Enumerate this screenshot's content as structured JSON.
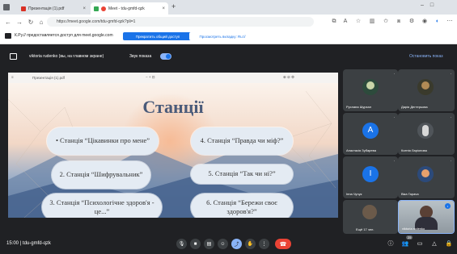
{
  "browser": {
    "tabs": [
      {
        "label": "Презентація (1).pdf",
        "active": false
      },
      {
        "label": "Meet - tdu-gmfd-qzk",
        "active": true
      }
    ],
    "new_tab_icon": "plus-icon",
    "url": "https://meet.google.com/tdu-gmfd-qzk?pli=1",
    "share_message": "К.Ру.// предоставляется доступ для meet.google.com",
    "share_primary_button": "Прекратить общий доступ",
    "share_secondary_button": "Просмотреть вкладку: Ru://"
  },
  "meet": {
    "presenter_label": "viktoria rudenko (вы, на главном экране)",
    "sound_label": "Звук показа",
    "stop_presenting": "Остановить показ",
    "meeting_time": "15:00",
    "meeting_code": "tdu-gmfd-qzk",
    "others_count": "Ещё 17 чел.",
    "participants_badge": "25",
    "participants": [
      {
        "name": "Руслана Шурхал",
        "kind": "photo",
        "color": "#2d4b3c"
      },
      {
        "name": "Дарія Дегтерьова",
        "kind": "photo",
        "color": "#3a3a2c"
      },
      {
        "name": "Анастасія Зубарева",
        "kind": "letter",
        "letter": "A",
        "color": "#1a73e8"
      },
      {
        "name": "Ксенія Ларіонова",
        "kind": "photo",
        "color": "#50555a"
      },
      {
        "name": "Інна Чучук",
        "kind": "letter",
        "letter": "І",
        "color": "#1a73e8"
      },
      {
        "name": "Віка Гарача",
        "kind": "photo",
        "color": "#2c4a7a"
      },
      {
        "name": "viktoria rudenko",
        "kind": "self",
        "color": "#7a8490"
      }
    ]
  },
  "slide": {
    "toolbar_text": "Презентація (1).pdf",
    "title": "Станції",
    "stations": [
      "• Станція “Цікавинки про мене”",
      "2. Станція “Шифрувальник”",
      "3. Станція “Психологічне здоров'я - це...”",
      "4. Станція “Правда чи міф?”",
      "5. Станція “Так чи ні?”",
      "6. Станція “Бережи своє здоров'я?”"
    ]
  },
  "colors": {
    "accent": "#8ab4f8",
    "end_call": "#ea4335",
    "tile_bg": "#3c4043",
    "pill_bg": "#e4ebf3",
    "title": "#4a5b7a"
  }
}
